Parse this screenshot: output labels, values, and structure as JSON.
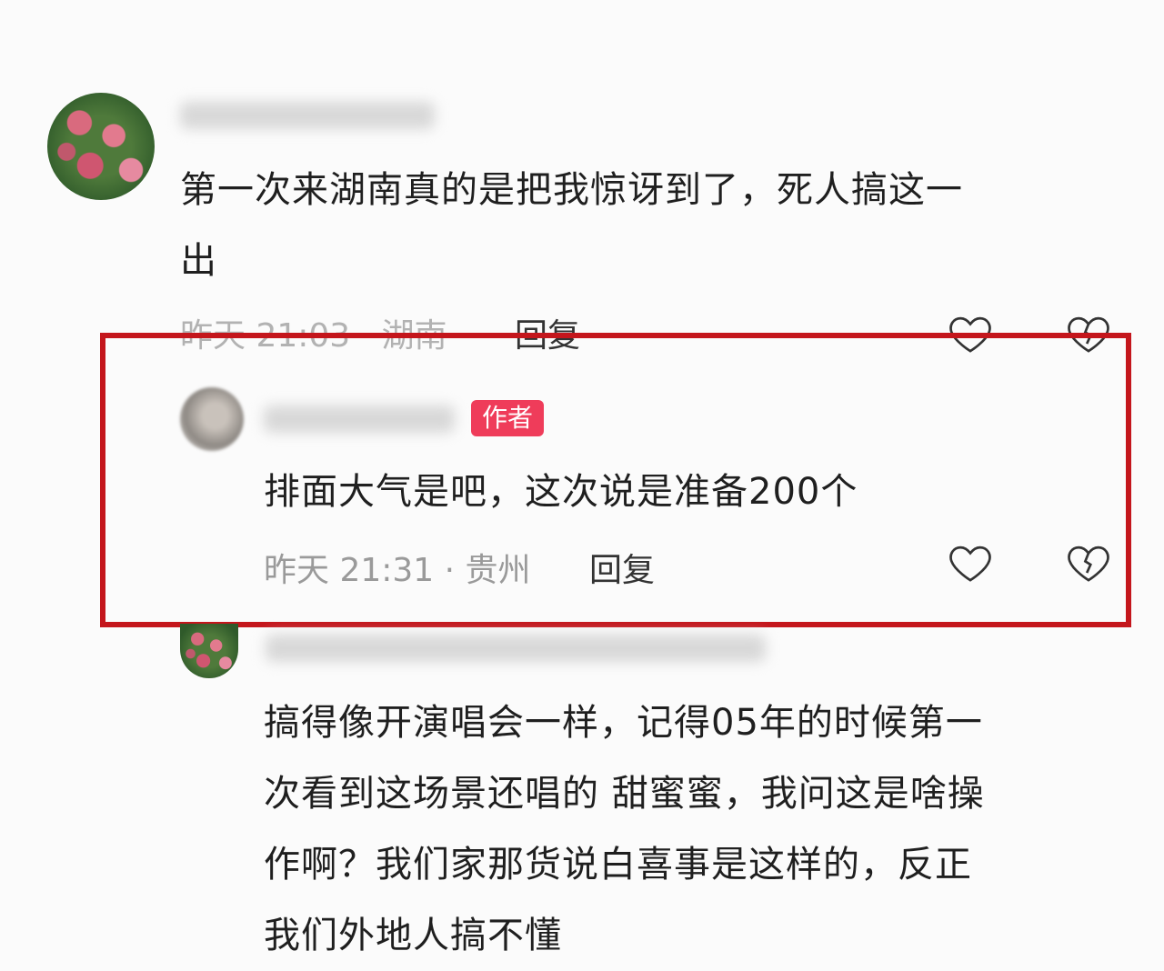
{
  "comments": [
    {
      "text": "第一次来湖南真的是把我惊讶到了，死人搞这一\n出",
      "time_location": "昨天 21:03 · 湖南",
      "reply_label": "回复"
    },
    {
      "badge": "作者",
      "text": "排面大气是吧，这次说是准备200个",
      "time_location": "昨天 21:31 · 贵州",
      "reply_label": "回复"
    },
    {
      "text": "搞得像开演唱会一样，记得05年的时候第一\n次看到这场景还唱的 甜蜜蜜，我问这是啥操\n作啊？我们家那货说白喜事是这样的，反正\n我们外地人搞不懂"
    }
  ],
  "icons": {
    "like": "heart-outline-icon",
    "dislike": "broken-heart-icon"
  },
  "colors": {
    "highlight_border": "#c4161c",
    "author_badge": "#ef3c5a"
  }
}
